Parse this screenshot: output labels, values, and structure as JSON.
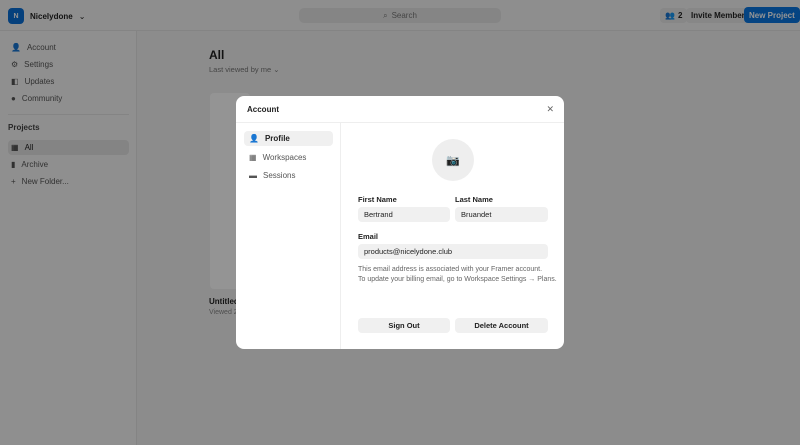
{
  "topbar": {
    "workspace_initial": "N",
    "workspace_name": "Nicelydone",
    "search_placeholder": "Search",
    "member_count": "2",
    "invite_label": "Invite Member",
    "new_project_label": "New Project"
  },
  "sidebar": {
    "items": [
      {
        "label": "Account"
      },
      {
        "label": "Settings"
      },
      {
        "label": "Updates"
      },
      {
        "label": "Community"
      }
    ],
    "projects_heading": "Projects",
    "projects": [
      {
        "label": "All"
      },
      {
        "label": "Archive"
      },
      {
        "label": "New Folder..."
      }
    ]
  },
  "main": {
    "title": "All",
    "sort_label": "Last viewed by me",
    "project_title": "Untitled",
    "project_sub": "Viewed 2"
  },
  "modal": {
    "title": "Account",
    "nav": [
      {
        "label": "Profile"
      },
      {
        "label": "Workspaces"
      },
      {
        "label": "Sessions"
      }
    ],
    "first_name_label": "First Name",
    "first_name": "Bertrand",
    "last_name_label": "Last Name",
    "last_name": "Bruandet",
    "email_label": "Email",
    "email": "products@nicelydone.club",
    "note_line1": "This email address is associated with your Framer account.",
    "note_line2": "To update your billing email, go to Workspace Settings → Plans.",
    "sign_out": "Sign Out",
    "delete_account": "Delete Account"
  }
}
